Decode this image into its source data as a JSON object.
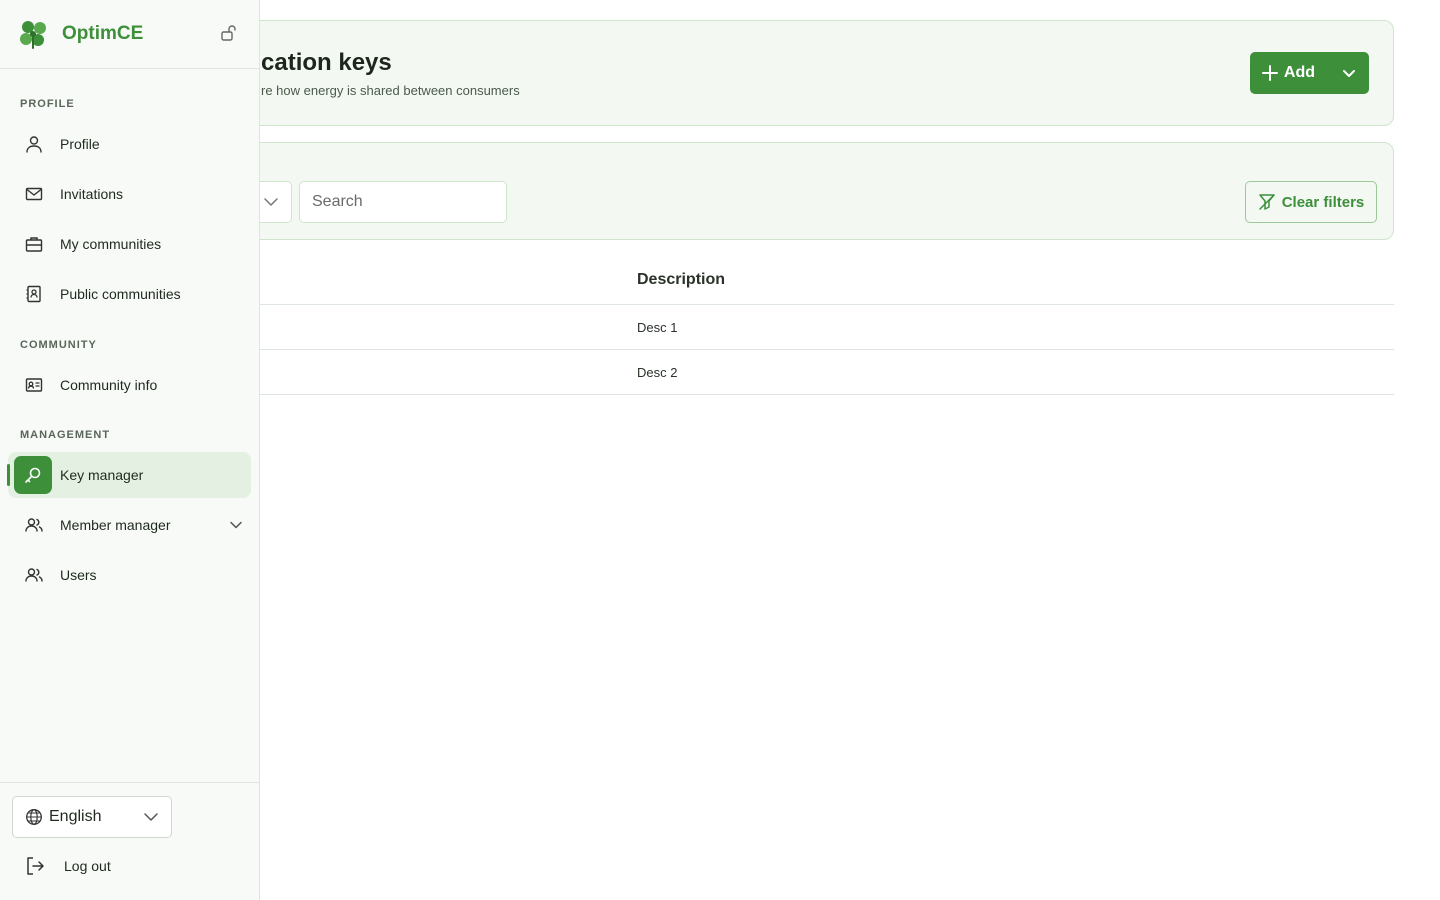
{
  "header": {
    "title": "cation keys",
    "subtitle": "re how energy is shared between consumers",
    "add_label": "Add"
  },
  "filters": {
    "search_placeholder": "Search",
    "clear_label": "Clear filters"
  },
  "table": {
    "columns": {
      "description": "Description"
    },
    "rows": [
      {
        "description": "Desc 1"
      },
      {
        "description": "Desc 2"
      }
    ]
  },
  "sidebar": {
    "brand": "OptimCE",
    "sections": {
      "profile": "PROFILE",
      "community": "COMMUNITY",
      "management": "MANAGEMENT"
    },
    "items": {
      "profile": "Profile",
      "invitations": "Invitations",
      "my_communities": "My communities",
      "public_communities": "Public communities",
      "community_info": "Community info",
      "key_manager": "Key manager",
      "member_manager": "Member manager",
      "users": "Users"
    },
    "language": "English",
    "logout": "Log out"
  },
  "colors": {
    "accent": "#3d8f3a",
    "card_bg": "#f3f9f2",
    "card_border": "#cfe6cc",
    "sidebar_bg": "#f7faf6",
    "active_bg": "#e4f1e2"
  }
}
